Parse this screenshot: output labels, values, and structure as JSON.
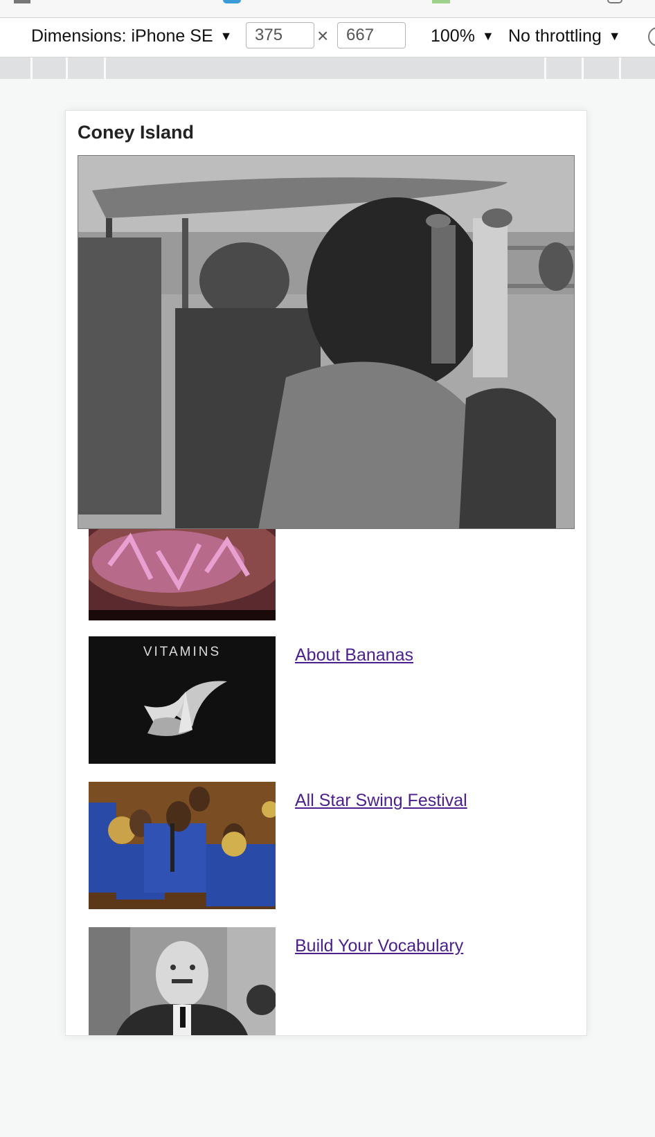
{
  "toolbar": {
    "dimensions_label": "Dimensions: iPhone SE",
    "width_value": "375",
    "height_value": "667",
    "times": "×",
    "zoom": "100%",
    "throttling": "No throttling",
    "caret": "▼"
  },
  "page": {
    "title": "Coney Island",
    "videos": [
      {
        "title": "About Bananas",
        "thumb_text": "VITAMINS"
      },
      {
        "title": "All Star Swing Festival"
      },
      {
        "title": "Build Your Vocabulary"
      }
    ]
  },
  "colors": {
    "link": "#4b1f8c",
    "title": "#222222",
    "ruler": "#dfe0e2"
  }
}
